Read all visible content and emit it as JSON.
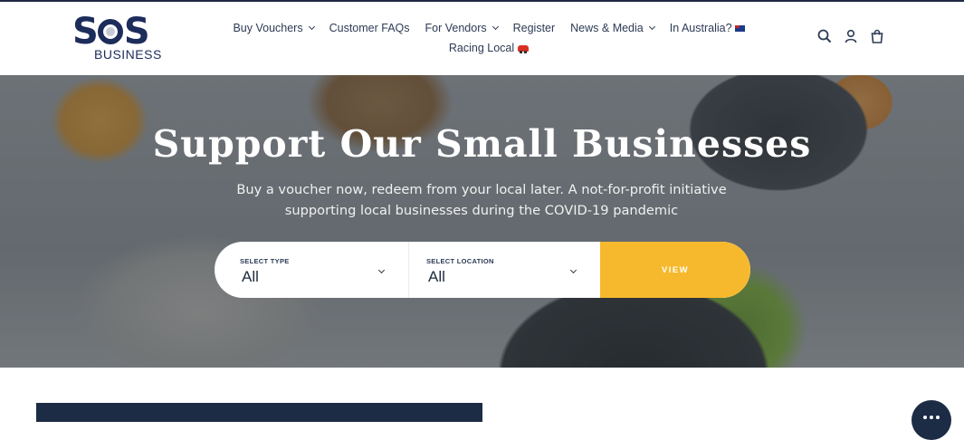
{
  "brand": {
    "logo_text": "SOS",
    "logo_subtext": "BUSINESS"
  },
  "nav": {
    "items": [
      {
        "label": "Buy Vouchers",
        "dropdown": true
      },
      {
        "label": "Customer FAQs",
        "dropdown": false
      },
      {
        "label": "For Vendors",
        "dropdown": true
      },
      {
        "label": "Register",
        "dropdown": false
      },
      {
        "label": "News & Media",
        "dropdown": true
      },
      {
        "label": "In Australia?",
        "dropdown": false
      },
      {
        "label": "Racing Local",
        "dropdown": false
      }
    ]
  },
  "header_icons": [
    "search-icon",
    "account-icon",
    "cart-icon"
  ],
  "hero": {
    "title": "Support Our Small Businesses",
    "subtitle": "Buy a voucher now, redeem from your local later. A not-for-profit initiative supporting local businesses during the COVID-19 pandemic"
  },
  "search": {
    "type_label": "SELECT TYPE",
    "type_value": "All",
    "location_label": "SELECT LOCATION",
    "location_value": "All",
    "button_label": "VIEW"
  },
  "colors": {
    "navy": "#1c2c45",
    "accent": "#f6b92d",
    "text": "#2d3b55"
  }
}
